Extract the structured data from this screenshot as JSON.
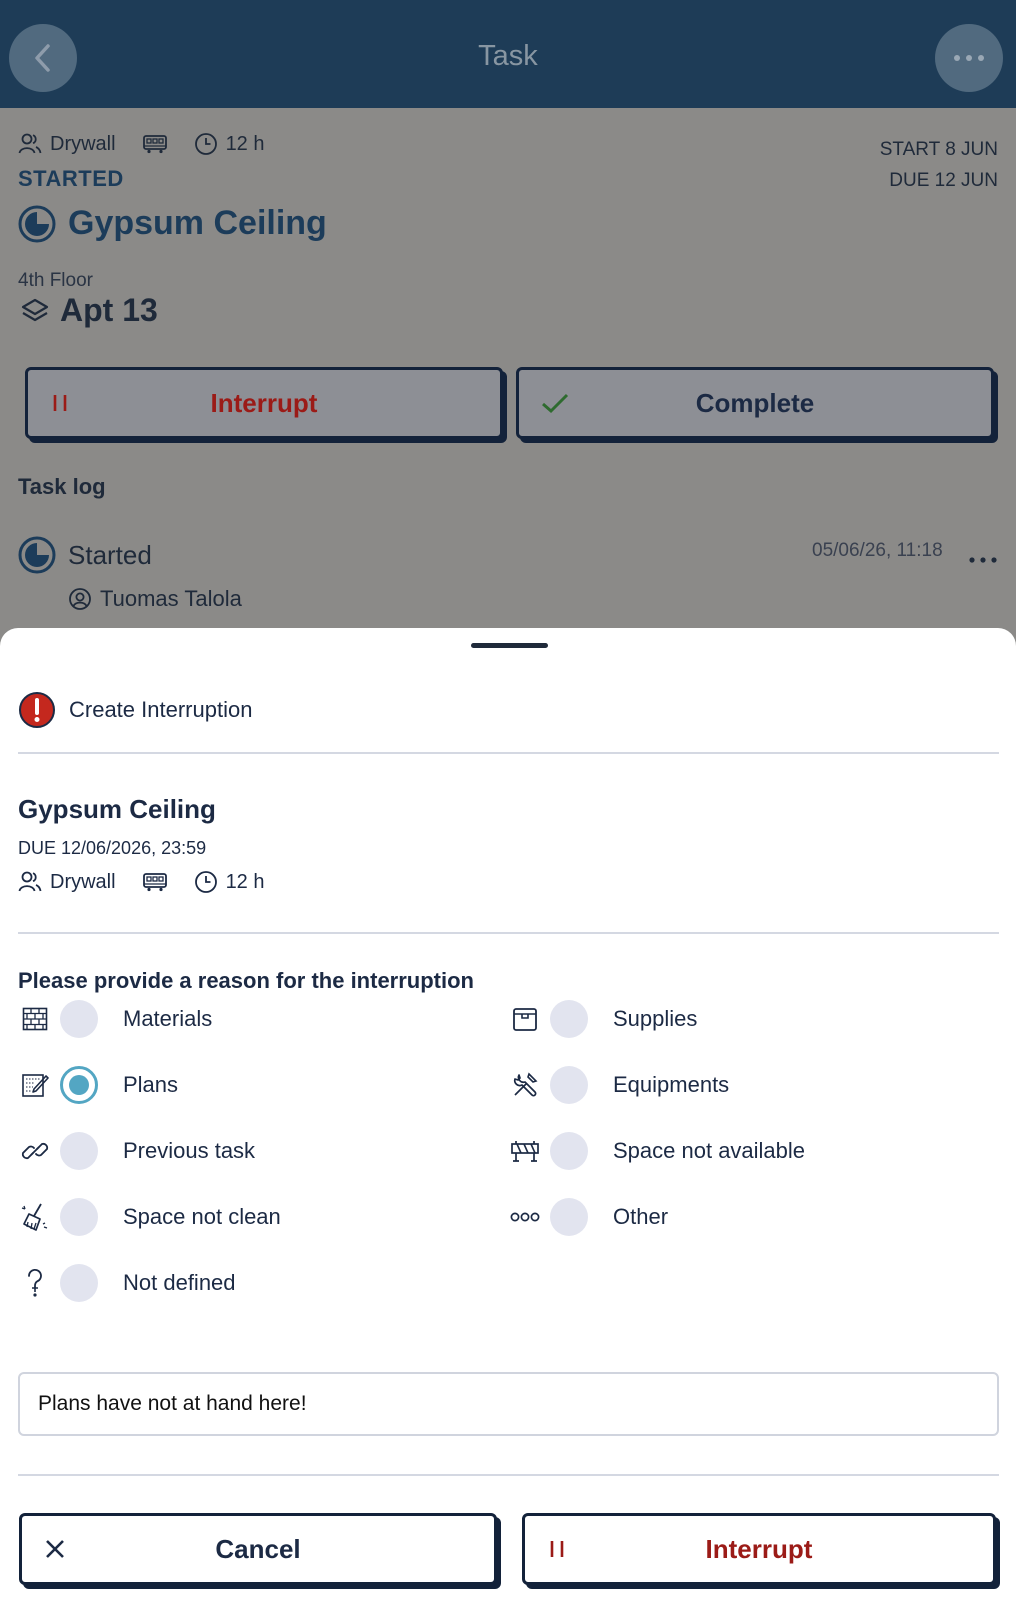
{
  "header": {
    "title": "Task",
    "back_icon": "chevron-left-icon",
    "more_icon": "more-horizontal-icon"
  },
  "task": {
    "team": "Drywall",
    "duration": "12 h",
    "status": "STARTED",
    "start": "START 8 JUN",
    "due": "DUE 12 JUN",
    "title": "Gypsum Ceiling",
    "floor": "4th Floor",
    "apartment": "Apt 13"
  },
  "actions": {
    "interrupt": "Interrupt",
    "complete": "Complete"
  },
  "task_log": {
    "heading": "Task log",
    "entries": [
      {
        "status": "Started",
        "time": "05/06/26, 11:18",
        "user": "Tuomas Talola"
      }
    ]
  },
  "sheet": {
    "title": "Create Interruption",
    "task_title": "Gypsum Ceiling",
    "due": "DUE 12/06/2026, 23:59",
    "team": "Drywall",
    "duration": "12 h",
    "reason_heading": "Please provide a reason for the interruption",
    "reasons": [
      {
        "label": "Materials",
        "icon": "brick-wall-icon",
        "selected": false
      },
      {
        "label": "Supplies",
        "icon": "box-icon",
        "selected": false
      },
      {
        "label": "Plans",
        "icon": "blueprint-icon",
        "selected": true
      },
      {
        "label": "Equipments",
        "icon": "tools-icon",
        "selected": false
      },
      {
        "label": "Previous task",
        "icon": "chain-link-icon",
        "selected": false
      },
      {
        "label": "Space not available",
        "icon": "barrier-icon",
        "selected": false
      },
      {
        "label": "Space not clean",
        "icon": "broom-icon",
        "selected": false
      },
      {
        "label": "Other",
        "icon": "three-circles-icon",
        "selected": false
      },
      {
        "label": "Not defined",
        "icon": "question-icon",
        "selected": false
      }
    ],
    "note_value": "Plans have not at hand here!",
    "cancel_label": "Cancel",
    "interrupt_label": "Interrupt"
  },
  "colors": {
    "header_bg": "#1e3c57",
    "accent_red": "#9b1b17",
    "accent_green": "#2e7d32",
    "radio_selected": "#53a6c3",
    "title_blue": "#1c3c5a"
  }
}
